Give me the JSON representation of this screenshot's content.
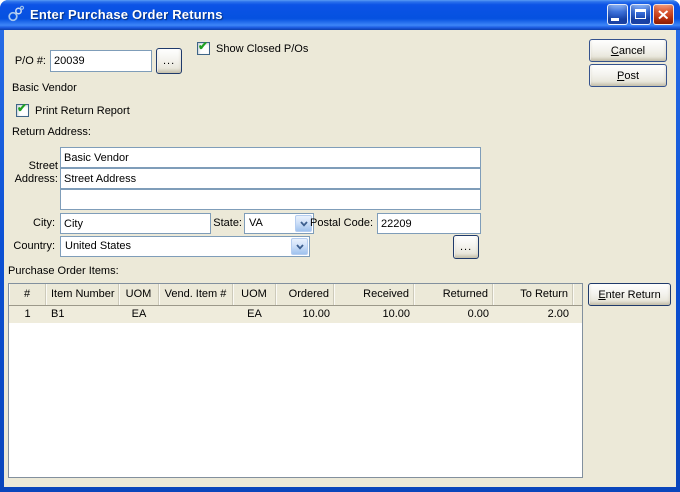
{
  "colors": {
    "titlebar_blue": "#0b50d8",
    "dialog_background": "#ece9d8",
    "close_button_red": "#d9451f",
    "checkbox_check_green": "#21a121",
    "input_border_blue": "#7f9db9"
  },
  "titlebar": {
    "title": "Enter Purchase Order Returns"
  },
  "top": {
    "show_closed": {
      "label": "Show Closed P/Os",
      "checked": true
    },
    "po_number": {
      "label": "P/O #:",
      "value": "20039"
    },
    "po_browse_label": "...",
    "cancel_button": {
      "accel": "C",
      "rest": "ancel"
    },
    "post_button": {
      "accel": "P",
      "rest": "ost"
    }
  },
  "vendor": {
    "name": "Basic Vendor",
    "print_return": {
      "label": "Print Return Report",
      "checked": true
    },
    "return_address_label": "Return Address:",
    "street_label": {
      "line1": "Street",
      "line2": "Address:"
    },
    "address_line1": "Basic Vendor",
    "address_line2": "Street Address",
    "address_line3": "",
    "city": {
      "label": "City:",
      "value": "City"
    },
    "state": {
      "label": "State:",
      "value": "VA"
    },
    "postal": {
      "label": "Postal Code:",
      "value": "22209"
    },
    "country": {
      "label": "Country:",
      "value": "United States"
    },
    "country_browse_label": "..."
  },
  "items": {
    "section_label": "Purchase Order Items:",
    "enter_return_button": {
      "accel": "E",
      "rest": "nter Return"
    },
    "table": {
      "columns": [
        "#",
        "Item Number",
        "UOM",
        "Vend. Item #",
        "UOM",
        "Ordered",
        "Received",
        "Returned",
        "To Return"
      ],
      "rows": [
        [
          "1",
          "B1",
          "EA",
          "",
          "EA",
          "10.00",
          "10.00",
          "0.00",
          "2.00"
        ]
      ]
    }
  }
}
